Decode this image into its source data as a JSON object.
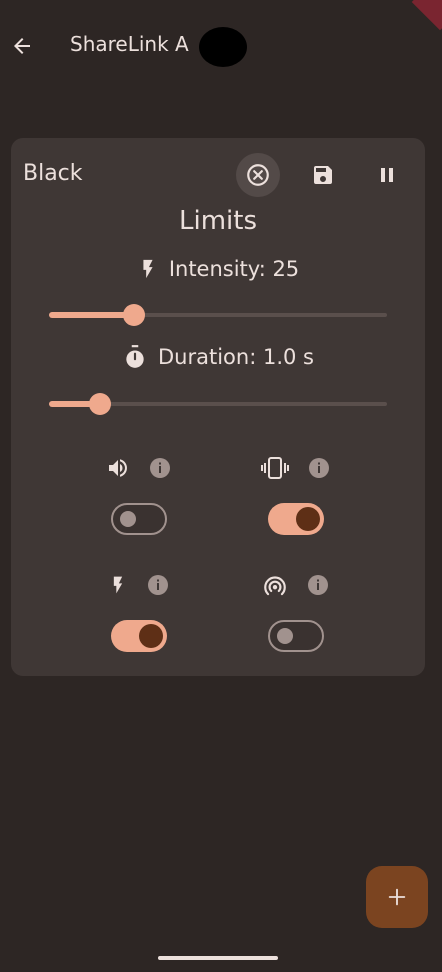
{
  "appbar": {
    "title": "ShareLink A",
    "back_icon": "arrow-left-icon"
  },
  "card": {
    "title": "Black",
    "actions": {
      "close_icon": "close-circle-icon",
      "save_icon": "save-icon",
      "pause_icon": "pause-icon"
    },
    "section_title": "Limits",
    "intensity": {
      "label": "Intensity: 25",
      "icon": "bolt-icon",
      "value_fraction": 0.25
    },
    "duration": {
      "label": "Duration: 1.0 s",
      "icon": "timer-icon",
      "value_fraction": 0.15
    },
    "features": [
      {
        "icon": "volume-icon",
        "info_icon": "info-icon",
        "enabled": false
      },
      {
        "icon": "vibration-icon",
        "info_icon": "info-icon",
        "enabled": true
      },
      {
        "icon": "bolt-icon",
        "info_icon": "info-icon",
        "enabled": true
      },
      {
        "icon": "wireless-icon",
        "info_icon": "info-icon",
        "enabled": false
      }
    ]
  },
  "fab": {
    "icon": "plus-icon"
  },
  "colors": {
    "background": "#2d2624",
    "card": "#3f3735",
    "accent": "#efa98d",
    "switch_knob_on": "#5e2f16",
    "fab": "#7b4420",
    "text": "#ece0dc"
  }
}
